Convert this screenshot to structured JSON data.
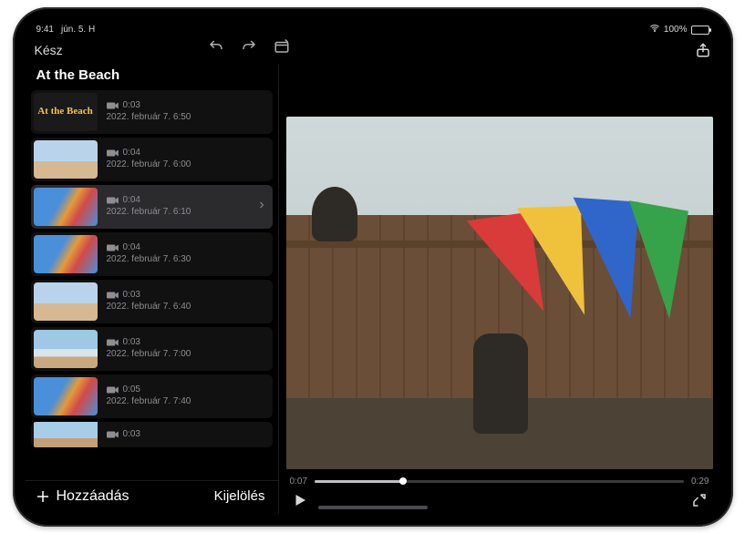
{
  "status": {
    "time": "9:41",
    "date": "jún. 5. H",
    "battery_pct": "100%"
  },
  "toolbar": {
    "done": "Kész"
  },
  "project": {
    "title": "At the Beach"
  },
  "clips": [
    {
      "title_card": "At the Beach",
      "duration": "0:03",
      "timestamp": "2022. február 7. 6:50",
      "selected": false
    },
    {
      "duration": "0:04",
      "timestamp": "2022. február 7. 6:00",
      "selected": false
    },
    {
      "duration": "0:04",
      "timestamp": "2022. február 7. 6:10",
      "selected": true
    },
    {
      "duration": "0:04",
      "timestamp": "2022. február 7. 6:30",
      "selected": false
    },
    {
      "duration": "0:03",
      "timestamp": "2022. február 7. 6:40",
      "selected": false
    },
    {
      "duration": "0:03",
      "timestamp": "2022. február 7. 7:00",
      "selected": false
    },
    {
      "duration": "0:05",
      "timestamp": "2022. február 7. 7:40",
      "selected": false
    },
    {
      "duration": "0:03",
      "timestamp": "",
      "selected": false
    }
  ],
  "sidebar_actions": {
    "add": "Hozzáadás",
    "select": "Kijelölés"
  },
  "player": {
    "current": "0:07",
    "total": "0:29"
  }
}
